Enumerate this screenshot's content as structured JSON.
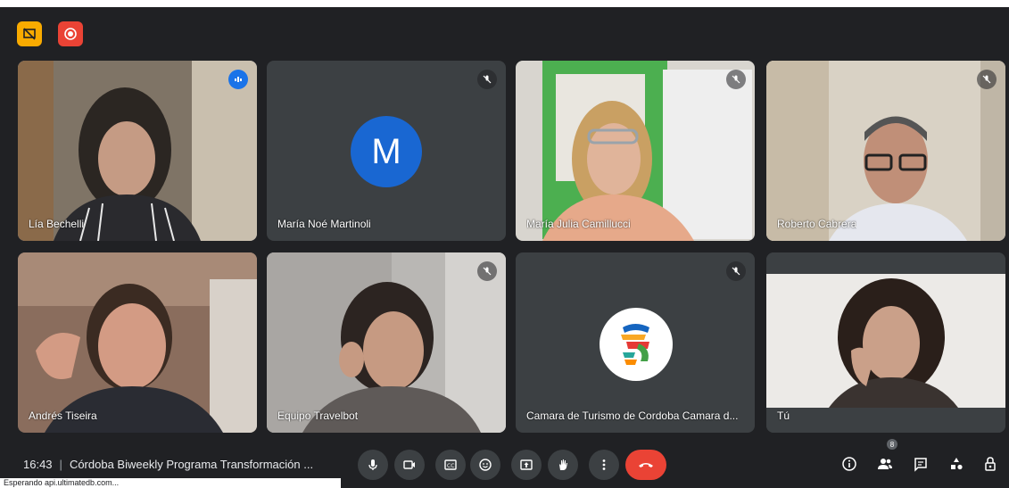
{
  "participants": [
    {
      "name": "Lía Bechelli"
    },
    {
      "name": "María Noé Martinoli",
      "initial": "M"
    },
    {
      "name": "María Julia Camillucci"
    },
    {
      "name": "Roberto Cabrera"
    },
    {
      "name": "Andrés Tiseira"
    },
    {
      "name": "Equipo Travelbot"
    },
    {
      "name": "Camara de Turismo de Cordoba Camara d..."
    },
    {
      "name": "Tú"
    }
  ],
  "meeting": {
    "time": "16:43",
    "separator": "|",
    "title": "Córdoba Biweekly Programa Transformación ..."
  },
  "people_count": "8",
  "status_text": "Esperando api.ultimatedb.com...",
  "colors": {
    "background": "#202124",
    "tile": "#3c4043",
    "end_call": "#ea4335",
    "active_border": "#8ab4f8",
    "avatar": "#1967d2"
  },
  "icons": [
    "presentation-off-icon",
    "record-icon",
    "mic-icon",
    "camera-icon",
    "captions-icon",
    "emoji-icon",
    "present-icon",
    "raise-hand-icon",
    "more-options-icon",
    "end-call-icon",
    "info-icon",
    "people-icon",
    "chat-icon",
    "activities-icon",
    "host-controls-icon",
    "mic-off-icon",
    "speaking-icon"
  ]
}
